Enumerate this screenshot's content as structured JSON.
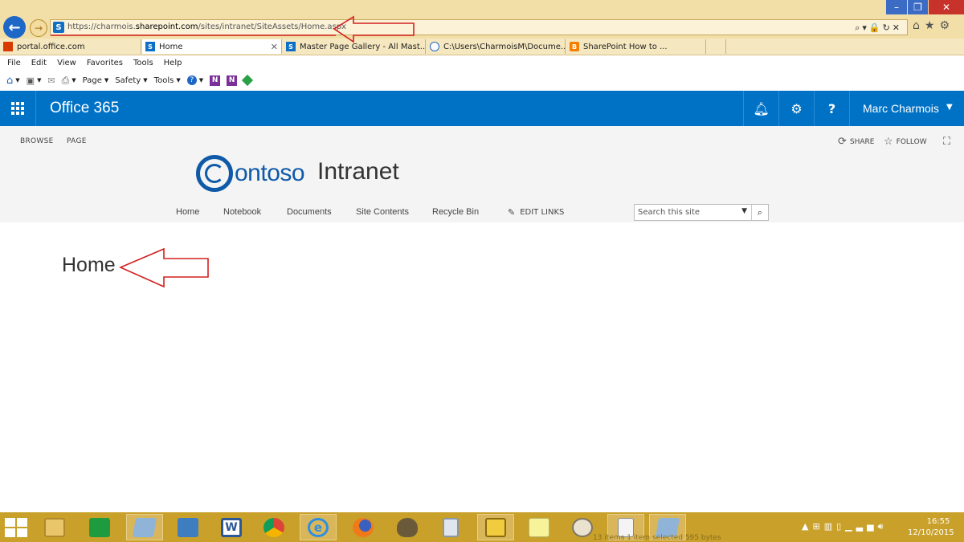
{
  "browser": {
    "url_prefix": "https://charmois.",
    "url_domain": "sharepoint.com",
    "url_path": "/sites/intranet/SiteAssets/Home.aspx",
    "address_icons": "⌕▾🔒↻✕",
    "tabs": [
      {
        "label": "portal.office.com",
        "active": false
      },
      {
        "label": "Home",
        "active": true
      },
      {
        "label": "Master Page Gallery - All Mast...",
        "active": false
      },
      {
        "label": "C:\\Users\\CharmoisM\\Docume...",
        "active": false
      },
      {
        "label": "SharePoint How to ...",
        "active": false
      }
    ],
    "tab_close": "✕",
    "menu": [
      "File",
      "Edit",
      "View",
      "Favorites",
      "Tools",
      "Help"
    ],
    "commands": {
      "page": "Page",
      "safety": "Safety",
      "tools": "Tools"
    }
  },
  "suitebar": {
    "title": "Office 365",
    "user": "Marc Charmois",
    "bg_color": "#0072c6"
  },
  "ribbon": {
    "browse": "BROWSE",
    "page": "PAGE",
    "share": "SHARE",
    "follow": "FOLLOW"
  },
  "site": {
    "logo_text": "ontoso",
    "title": "Intranet",
    "nav": [
      "Home",
      "Notebook",
      "Documents",
      "Site Contents",
      "Recycle Bin"
    ],
    "edit_links": "EDIT LINKS",
    "search_placeholder": "Search this site"
  },
  "content": {
    "page_title": "Home"
  },
  "taskbar": {
    "time": "16:55",
    "date": "12/10/2015",
    "ghost_status": "13 items     1 item selected  595 bytes"
  }
}
